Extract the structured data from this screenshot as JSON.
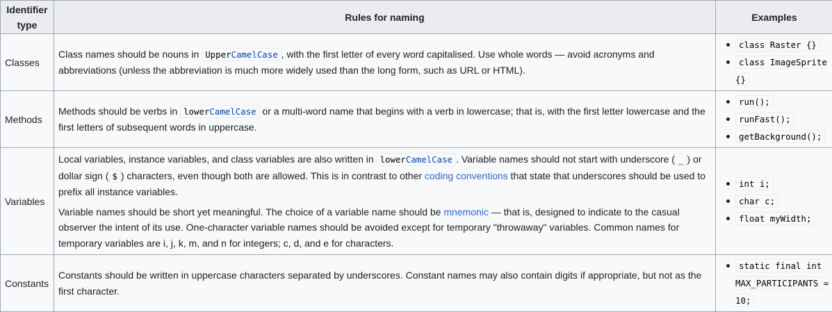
{
  "headers": {
    "col1": "Identifier type",
    "col2": "Rules for naming",
    "col3": "Examples"
  },
  "rows": [
    {
      "type": "Classes",
      "rule_pre": "Class names should be nouns in ",
      "rule_code_a": "Upper",
      "rule_code_b": "CamelCase",
      "rule_post": ", with the first letter of every word capitalised. Use whole words — avoid acronyms and abbreviations (unless the abbreviation is much more widely used than the long form, such as URL or HTML).",
      "examples": [
        "class Raster {}",
        "class ImageSprite {}"
      ]
    },
    {
      "type": "Methods",
      "rule_pre": "Methods should be verbs in ",
      "rule_code_a": "lower",
      "rule_code_b": "CamelCase",
      "rule_post": " or a multi-word name that begins with a verb in lowercase; that is, with the first letter lowercase and the first letters of subsequent words in uppercase.",
      "examples": [
        "run();",
        "runFast();",
        "getBackground();"
      ]
    },
    {
      "type": "Variables",
      "p1_pre": "Local variables, instance variables, and class variables are also written in ",
      "p1_code_a": "lower",
      "p1_code_b": "CamelCase",
      "p1_mid1": ". Variable names should not start with underscore (",
      "p1_underscore": "_",
      "p1_mid2": ") or dollar sign (",
      "p1_dollar": "$",
      "p1_mid3": ") characters, even though both are allowed. This is in contrast to other ",
      "p1_link": "coding conventions",
      "p1_post": " that state that underscores should be used to prefix all instance variables.",
      "p2_pre": "Variable names should be short yet meaningful. The choice of a variable name should be ",
      "p2_link": "mnemonic",
      "p2_post": " — that is, designed to indicate to the casual observer the intent of its use. One-character variable names should be avoided except for temporary \"throwaway\" variables. Common names for temporary variables are i, j, k, m, and n for integers; c, d, and e for characters.",
      "examples": [
        "int i;",
        "char c;",
        "float myWidth;"
      ]
    },
    {
      "type": "Constants",
      "rule": "Constants should be written in uppercase characters separated by underscores. Constant names may also contain digits if appropriate, but not as the first character.",
      "examples": [
        "static final int MAX_PARTICIPANTS = 10;"
      ]
    }
  ]
}
